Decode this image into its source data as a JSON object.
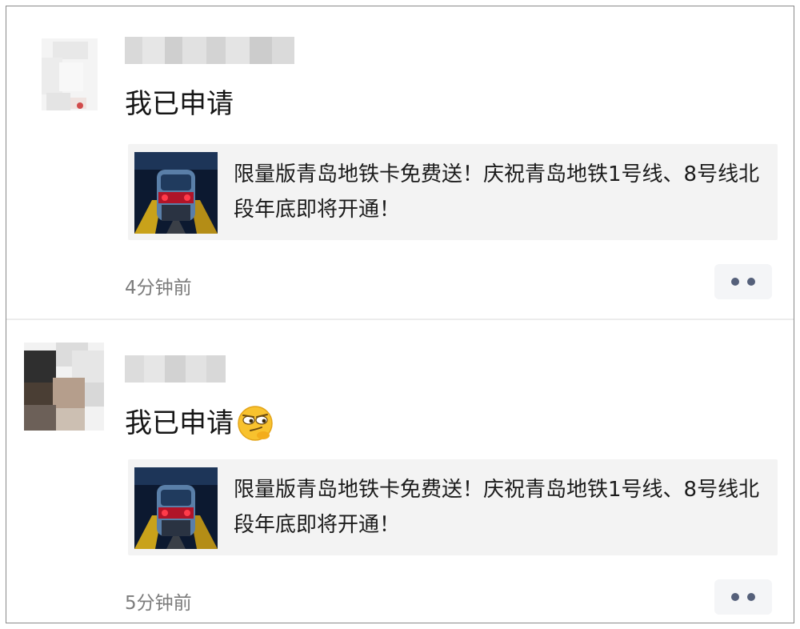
{
  "feed": {
    "posts": [
      {
        "text": "我已申请",
        "emoji": "",
        "link": {
          "title": "限量版青岛地铁卡免费送！庆祝青岛地铁1号线、8号线北段年底即将开通！",
          "thumbnail": "subway-train-icon"
        },
        "time": "4分钟前",
        "more_icon": "ellipsis-icon"
      },
      {
        "text": "我已申请",
        "emoji": "smirk-emoji-icon",
        "link": {
          "title": "限量版青岛地铁卡免费送！庆祝青岛地铁1号线、8号线北段年底即将开通！",
          "thumbnail": "subway-train-icon"
        },
        "time": "5分钟前",
        "more_icon": "ellipsis-icon"
      }
    ]
  },
  "colors": {
    "card_background": "#f3f3f3",
    "timestamp": "#7c7c7c",
    "more_dots": "#55607a",
    "train_lights": "#e0203a"
  }
}
